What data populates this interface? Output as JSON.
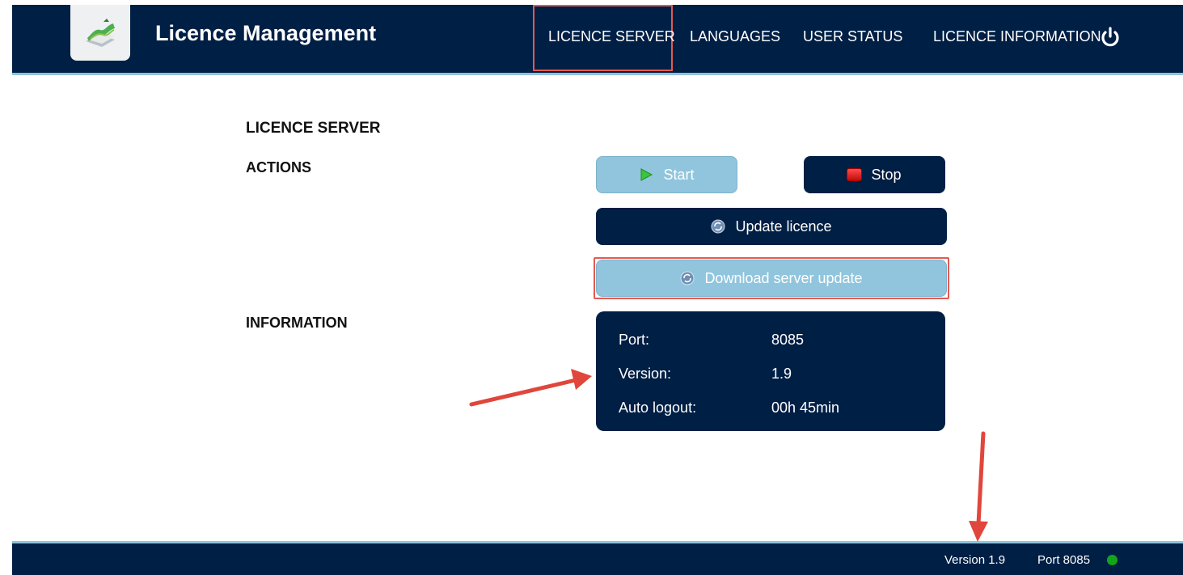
{
  "header": {
    "app_title": "Licence Management",
    "logo_icon": "map-terrain-icon",
    "nav": [
      {
        "label": "LICENCE SERVER",
        "active": true
      },
      {
        "label": "LANGUAGES",
        "active": false
      },
      {
        "label": "USER STATUS",
        "active": false
      },
      {
        "label": "LICENCE INFORMATION",
        "active": false
      }
    ],
    "power_icon": "power-icon"
  },
  "main": {
    "page_title": "LICENCE SERVER",
    "actions_label": "ACTIONS",
    "information_label": "INFORMATION",
    "buttons": {
      "start": "Start",
      "stop": "Stop",
      "update_licence": "Update licence",
      "download_server_update": "Download server update"
    },
    "info": {
      "port_label": "Port:",
      "port_value": "8085",
      "version_label": "Version:",
      "version_value": "1.9",
      "auto_logout_label": "Auto logout:",
      "auto_logout_value": "00h 45min"
    }
  },
  "footer": {
    "version": "Version 1.9",
    "port": "Port 8085",
    "status_color": "#12a51a"
  },
  "colors": {
    "navy": "#001f45",
    "light_blue": "#90c5dd",
    "highlight_red": "#e35a52"
  }
}
